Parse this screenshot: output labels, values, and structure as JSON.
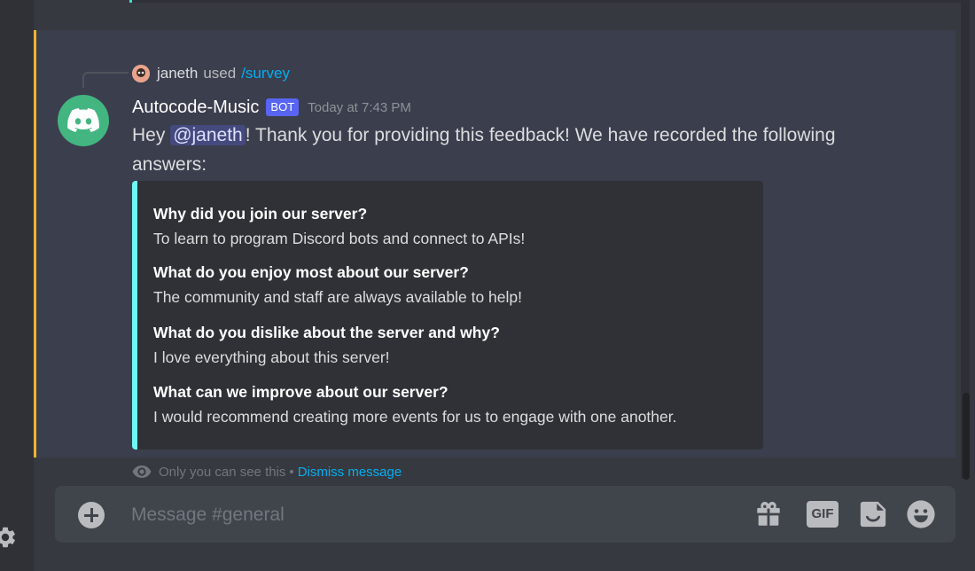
{
  "reply": {
    "username": "janeth",
    "used_text": "used",
    "command": "/survey"
  },
  "message": {
    "author": "Autocode-Music",
    "bot_tag": "BOT",
    "timestamp": "Today at 7:43 PM",
    "text_before_mention": "Hey ",
    "mention": "@janeth",
    "text_after_mention": "! Thank you for providing this feedback! We have recorded the following answers:"
  },
  "embed": {
    "accent_color": "#6ef8f4",
    "fields": [
      {
        "name": "Why did you join our server?",
        "value": "To learn to program Discord bots and connect to APIs!"
      },
      {
        "name": "What do you enjoy most about our server?",
        "value": "The community and staff are always available to help!"
      },
      {
        "name": "What do you dislike about the server and why?",
        "value": "I love everything about this server!"
      },
      {
        "name": "What can we improve about our server?",
        "value": "I would recommend creating more events for us to engage with one another."
      }
    ]
  },
  "ephemeral": {
    "notice": "Only you can see this",
    "separator": "•",
    "dismiss_label": "Dismiss message"
  },
  "composer": {
    "placeholder": "Message #general",
    "gif_label": "GIF"
  },
  "colors": {
    "background": "#36393f",
    "highlight": "#3b3e4d",
    "highlight_border": "#f0b232",
    "bot_tag": "#5865f2",
    "link": "#00aff4",
    "avatar": "#43b581"
  },
  "icons": {
    "settings": "gear-icon",
    "avatar": "discord-logo-icon",
    "visibility": "eye-icon",
    "upload": "plus-circle-icon",
    "gift": "gift-icon",
    "gif": "gif-icon",
    "sticker": "sticker-icon",
    "emoji": "emoji-icon"
  }
}
